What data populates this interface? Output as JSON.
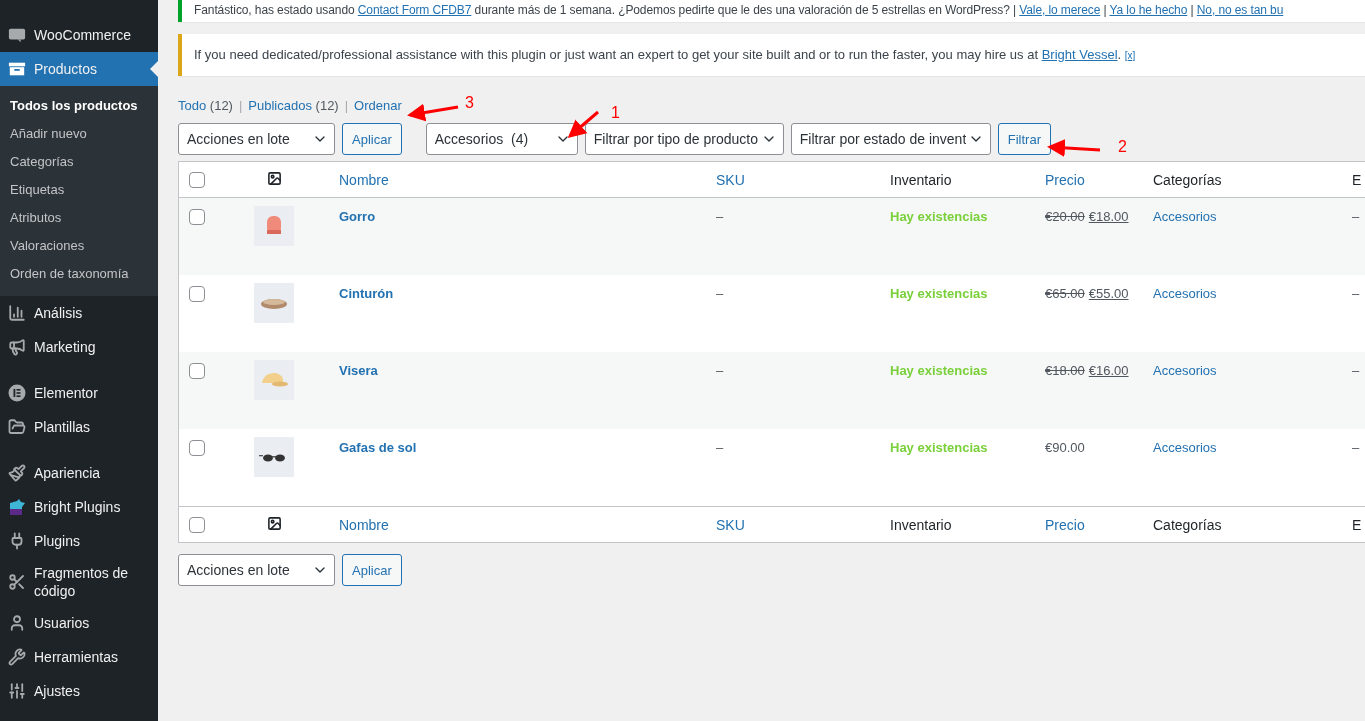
{
  "notices": [
    {
      "kind": "success",
      "parts": [
        {
          "kind": "text",
          "text": "Fantástico, has estado usando "
        },
        {
          "kind": "link",
          "text": "Contact Form CFDB7"
        },
        {
          "kind": "text",
          "text": " durante más de 1 semana. ¿Podemos pedirte que le des una valoración de 5 estrellas en WordPress? | "
        },
        {
          "kind": "link",
          "text": "Vale, lo merece"
        },
        {
          "kind": "text",
          "text": " | "
        },
        {
          "kind": "link",
          "text": "Ya lo he hecho"
        },
        {
          "kind": "text",
          "text": " | "
        },
        {
          "kind": "link",
          "text": "No, no es tan bu"
        }
      ]
    },
    {
      "kind": "warning",
      "parts": [
        {
          "kind": "text",
          "text": "If you need dedicated/professional assistance with this plugin or just want an expert to get your site built and or to run the faster, you may hire us at "
        },
        {
          "kind": "link",
          "text": "Bright Vessel"
        },
        {
          "kind": "text",
          "text": ". "
        },
        {
          "kind": "small_link",
          "text": "[x]"
        }
      ]
    }
  ],
  "sidebar": {
    "groups": [
      [
        {
          "label": "WooCommerce",
          "selected": false
        },
        {
          "label": "Productos",
          "selected": true,
          "children": [
            {
              "label": "Todos los productos",
              "selected": true
            },
            {
              "label": "Añadir nuevo",
              "selected": false
            },
            {
              "label": "Categorías",
              "selected": false
            },
            {
              "label": "Etiquetas",
              "selected": false
            },
            {
              "label": "Atributos",
              "selected": false
            },
            {
              "label": "Valoraciones",
              "selected": false
            },
            {
              "label": "Orden de taxonomía",
              "selected": false
            }
          ]
        },
        {
          "label": "Análisis",
          "selected": false
        },
        {
          "label": "Marketing",
          "selected": false
        }
      ],
      [
        {
          "label": "Elementor",
          "selected": false
        },
        {
          "label": "Plantillas",
          "selected": false
        }
      ],
      [
        {
          "label": "Apariencia",
          "selected": false
        },
        {
          "label": "Bright Plugins",
          "selected": false
        },
        {
          "label": "Plugins",
          "selected": false
        },
        {
          "label": "Fragmentos de código",
          "selected": false
        },
        {
          "label": "Usuarios",
          "selected": false
        },
        {
          "label": "Herramientas",
          "selected": false
        },
        {
          "label": "Ajustes",
          "selected": false
        }
      ]
    ]
  },
  "views": [
    {
      "label": "Todo",
      "count": "(12)",
      "selected": false,
      "separator": "|"
    },
    {
      "label": "Publicados",
      "count": "(12)",
      "selected": false,
      "separator": "|"
    },
    {
      "label": "Ordenar",
      "selected": false
    }
  ],
  "top_toolbar": {
    "bulk_action": "Acciones en lote",
    "apply": "Aplicar",
    "category_filter": "Accesorios  (4)",
    "type_filter": "Filtrar por tipo de producto",
    "stock_filter": "Filtrar por estado de invent",
    "filter_button": "Filtrar"
  },
  "table": {
    "columns": [
      {
        "kind": "check",
        "checked": false
      },
      {
        "kind": "thumb"
      },
      {
        "kind": "text",
        "label": "Nombre",
        "sortable": true
      },
      {
        "kind": "text",
        "label": "SKU",
        "sortable": true
      },
      {
        "kind": "text",
        "label": "Inventario",
        "sortable": false
      },
      {
        "kind": "text",
        "label": "Precio",
        "sortable": true
      },
      {
        "kind": "text",
        "label": "Categorías",
        "sortable": false
      },
      {
        "kind": "text",
        "label": "E",
        "sortable": false
      }
    ],
    "rows": [
      {
        "checked": false,
        "name": "Gorro",
        "sku": "–",
        "stock": "Hay existencias",
        "regular_price": "€20.00",
        "sale_price": "€18.00",
        "category": "Accesorios",
        "column_8": "–"
      },
      {
        "checked": false,
        "name": "Cinturón",
        "sku": "–",
        "stock": "Hay existencias",
        "regular_price": "€65.00",
        "sale_price": "€55.00",
        "category": "Accesorios",
        "column_8": "–"
      },
      {
        "checked": false,
        "name": "Visera",
        "sku": "–",
        "stock": "Hay existencias",
        "regular_price": "€18.00",
        "sale_price": "€16.00",
        "category": "Accesorios",
        "column_8": "–"
      },
      {
        "checked": false,
        "name": "Gafas de sol",
        "sku": "–",
        "stock": "Hay existencias",
        "regular_price": "€90.00",
        "category": "Accesorios",
        "column_8": "–"
      }
    ],
    "footer_columns": [
      {
        "kind": "check",
        "checked": false
      },
      {
        "kind": "thumb"
      },
      {
        "kind": "text",
        "label": "Nombre",
        "sortable": true
      },
      {
        "kind": "text",
        "label": "SKU",
        "sortable": true
      },
      {
        "kind": "text",
        "label": "Inventario",
        "sortable": false
      },
      {
        "kind": "text",
        "label": "Precio",
        "sortable": true
      },
      {
        "kind": "text",
        "label": "Categorías",
        "sortable": false
      },
      {
        "kind": "text",
        "label": "E",
        "sortable": false
      }
    ]
  },
  "bottom_toolbar": {
    "bulk_action": "Acciones en lote",
    "apply": "Aplicar"
  },
  "annotations": [
    {
      "label": "3"
    },
    {
      "label": "1"
    },
    {
      "label": "2"
    }
  ]
}
